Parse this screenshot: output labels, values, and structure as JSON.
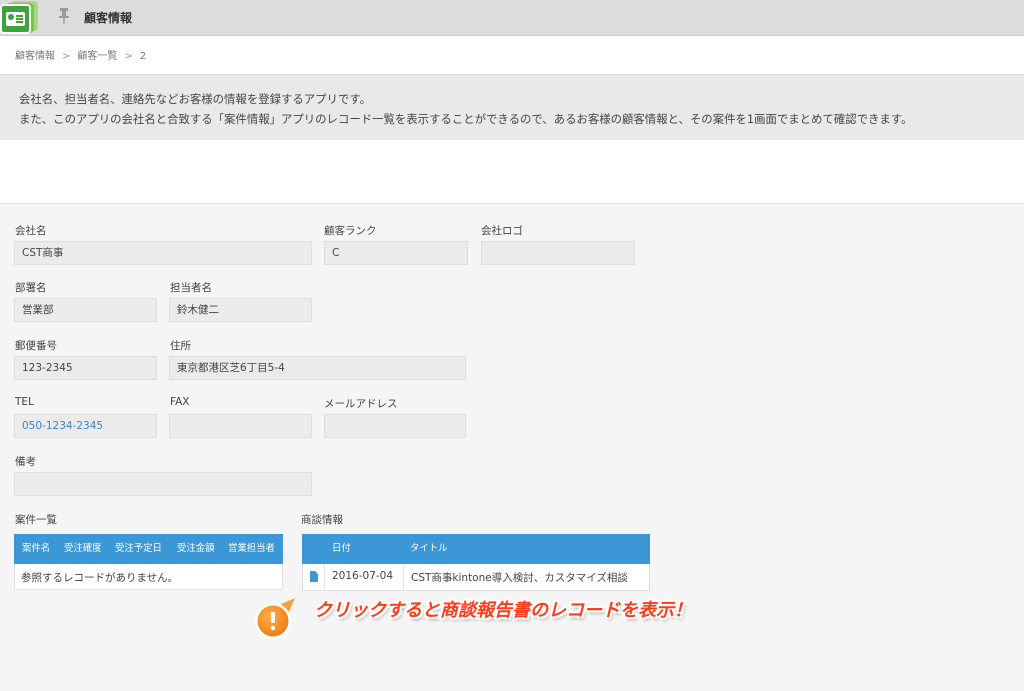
{
  "header": {
    "app_title": "顧客情報",
    "app_icon": "customer-card-icon",
    "pin_icon": "pin-icon"
  },
  "breadcrumb": {
    "items": [
      "顧客情報",
      "顧客一覧",
      "2"
    ],
    "separator": ">"
  },
  "description": {
    "line1": "会社名、担当者名、連絡先などお客様の情報を登録するアプリです。",
    "line2": "また、このアプリの会社名と合致する「案件情報」アプリのレコード一覧を表示することができるので、あるお客様の顧客情報と、その案件を1画面でまとめて確認できます。"
  },
  "form": {
    "company_name": {
      "label": "会社名",
      "value": "CST商事"
    },
    "customer_rank": {
      "label": "顧客ランク",
      "value": "C"
    },
    "company_logo": {
      "label": "会社ロゴ",
      "value": ""
    },
    "department": {
      "label": "部署名",
      "value": "営業部"
    },
    "contact_person": {
      "label": "担当者名",
      "value": "鈴木健二"
    },
    "postal_code": {
      "label": "郵便番号",
      "value": "123-2345"
    },
    "address": {
      "label": "住所",
      "value": "東京都港区芝6丁目5-4"
    },
    "tel": {
      "label": "TEL",
      "value": "050-1234-2345"
    },
    "fax": {
      "label": "FAX",
      "value": ""
    },
    "email": {
      "label": "メールアドレス",
      "value": ""
    },
    "notes": {
      "label": "備考",
      "value": ""
    }
  },
  "projects_table": {
    "label": "案件一覧",
    "columns": [
      "案件名",
      "受注確度",
      "受注予定日",
      "受注金額",
      "営業担当者"
    ],
    "empty_message": "参照するレコードがありません。"
  },
  "meetings_table": {
    "label": "商談情報",
    "columns": [
      "日付",
      "タイトル"
    ],
    "rows": [
      {
        "icon": "document-icon",
        "date": "2016-07-04",
        "title": "CST商事kintone導入検討、カスタマイズ相談"
      }
    ]
  },
  "callout": {
    "icon": "exclamation-icon",
    "text": "クリックすると商談報告書のレコードを表示！"
  },
  "colors": {
    "accent": "#3c97d7",
    "callout_text": "#ff3b18",
    "callout_badge": "#f28a1e",
    "link": "#3b84c5"
  }
}
